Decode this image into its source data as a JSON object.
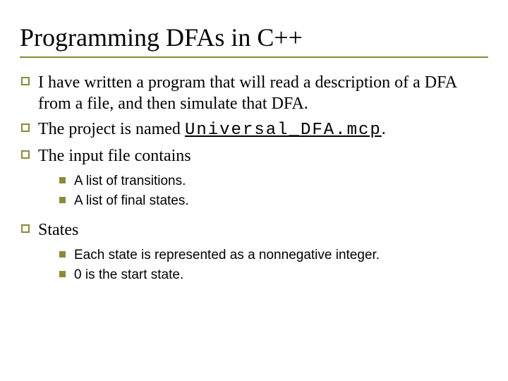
{
  "title": "Programming DFAs in C++",
  "bullets": [
    {
      "pre": "I have written a program that will read a description of a DFA from a file, and then simulate that DFA."
    },
    {
      "pre": "The project is named ",
      "code": "Universal_DFA.mcp",
      "post": "."
    },
    {
      "pre": "The input file contains",
      "sub": [
        "A list of transitions.",
        "A list of final states."
      ]
    },
    {
      "pre": "States",
      "sub": [
        "Each state is represented as a nonnegative integer.",
        "0 is the start state."
      ]
    }
  ]
}
